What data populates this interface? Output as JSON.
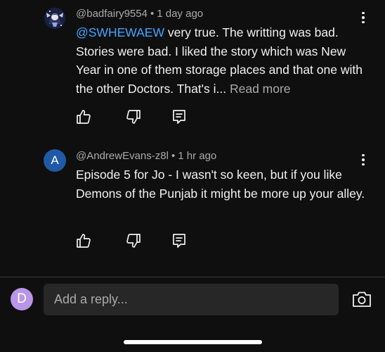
{
  "comments": [
    {
      "username": "@badfairy9554",
      "separator": "•",
      "time": "1 day ago",
      "mention": "@SWHEWAEW",
      "text": "very true. The writting was bad. Stories were bad. I liked the story which was New Year in one of them storage places and that one with the other Doctors. That's i...",
      "read_more": "Read more"
    },
    {
      "username": "@AndrewEvans-z8l",
      "separator": "•",
      "time": "1 hr ago",
      "avatar_letter": "A",
      "avatar_color": "#1f5aa6",
      "text": "Episode 5 for Jo - I wasn't so keen, but if you like Demons of the Punjab it might be more up your alley."
    }
  ],
  "reply_bar": {
    "avatar_letter": "D",
    "avatar_color": "#b996e8",
    "placeholder": "Add a reply..."
  },
  "icons": {
    "like": "thumbs-up-icon",
    "dislike": "thumbs-down-icon",
    "reply": "reply-icon",
    "more": "more-vertical-icon",
    "camera": "camera-icon"
  },
  "colors": {
    "background": "#0f0f0f",
    "mention": "#3ea6ff",
    "secondary_text": "#aaaaaa",
    "input_background": "#272727"
  }
}
